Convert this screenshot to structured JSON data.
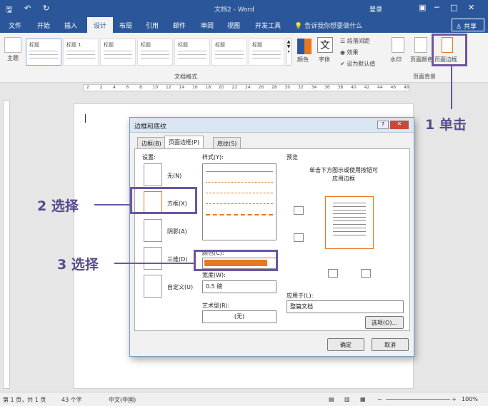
{
  "title_bar": {
    "doc_title": "文档2 - Word",
    "login": "登录"
  },
  "tabs": [
    "文件",
    "开始",
    "插入",
    "设计",
    "布局",
    "引用",
    "邮件",
    "审阅",
    "视图",
    "开发工具"
  ],
  "tell_me": "告诉我你想要做什么",
  "share": "共享",
  "ribbon": {
    "theme": "主题",
    "doc_format": "文档格式",
    "style_labels": [
      "标题",
      "标题 1",
      "标题",
      "标题",
      "标题",
      "标题",
      "标题",
      "标题"
    ],
    "colors": "颜色",
    "fonts": "字体",
    "paragraph_spacing": "段落间距",
    "effects": "效果",
    "set_default": "设为默认值",
    "watermark": "水印",
    "page_color": "页面颜色",
    "page_borders": "页面边框",
    "page_background": "页面背景"
  },
  "ruler_ticks": [
    "2",
    "2",
    "4",
    "6",
    "8",
    "10",
    "12",
    "14",
    "16",
    "18",
    "20",
    "22",
    "24",
    "26",
    "28",
    "30",
    "32",
    "34",
    "36",
    "38",
    "40",
    "42",
    "44",
    "46",
    "48"
  ],
  "dialog": {
    "title": "边框和底纹",
    "help": "?",
    "tabs": [
      "边框(B)",
      "页面边框(P)",
      "底纹(S)"
    ],
    "settings_label": "设置:",
    "settings": [
      "无(N)",
      "方框(X)",
      "阴影(A)",
      "三维(D)",
      "自定义(U)"
    ],
    "style_label": "样式(Y):",
    "color_label": "颜色(C):",
    "width_label": "宽度(W):",
    "width_value": "0.5 磅",
    "art_label": "艺术型(R):",
    "art_value": "(无)",
    "preview_label": "预览",
    "preview_hint_1": "单击下方图示或使用按钮可",
    "preview_hint_2": "应用边框",
    "apply_label": "应用于(L):",
    "apply_value": "整篇文档",
    "options": "选项(O)...",
    "ok": "确定",
    "cancel": "取消",
    "border_color": "#e87722"
  },
  "callouts": {
    "c1": "1 单击",
    "c2": "2 选择",
    "c3": "3 选择"
  },
  "status": {
    "page": "第 1 页，共 1 页",
    "words": "43 个字",
    "lang": "中文(中国)",
    "zoom": "100%"
  },
  "colors": {
    "word_blue": "#2b579a",
    "callout": "#6d55a3"
  }
}
